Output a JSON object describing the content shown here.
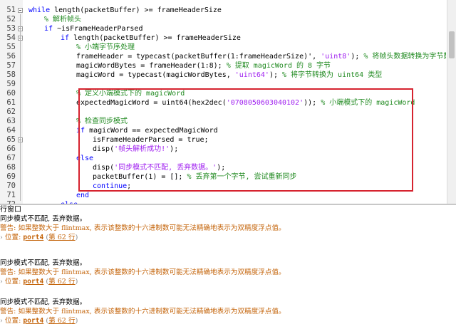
{
  "editor": {
    "lines": [
      {
        "num": "51",
        "fold": true
      },
      {
        "num": "52"
      },
      {
        "num": "53",
        "fold": true
      },
      {
        "num": "54",
        "fold": true
      },
      {
        "num": "55"
      },
      {
        "num": "56"
      },
      {
        "num": "57"
      },
      {
        "num": "58"
      },
      {
        "num": "59"
      },
      {
        "num": "60"
      },
      {
        "num": "61"
      },
      {
        "num": "62"
      },
      {
        "num": "63"
      },
      {
        "num": "64"
      },
      {
        "num": "65",
        "fold": true
      },
      {
        "num": "66"
      },
      {
        "num": "67"
      },
      {
        "num": "68"
      },
      {
        "num": "69"
      },
      {
        "num": "70"
      },
      {
        "num": "71"
      },
      {
        "num": "72"
      },
      {
        "num": "73"
      }
    ],
    "code": {
      "l51_kw": "while",
      "l51_rest": " length(packetBuffer) >= frameHeaderSize",
      "l52_cm": "% 解析帧头",
      "l53_kw": "if",
      "l53_rest": " ~isFrameHeaderParsed",
      "l54_kw": "if",
      "l54_rest": " length(packetBuffer) >= frameHeaderSize",
      "l55_cm": "% 小端字节序处理",
      "l56_a": "frameHeader = typecast(packetBuffer(1:frameHeaderSize)', ",
      "l56_str": "'uint8'",
      "l56_b": "); ",
      "l56_cm": "% 将帧头数据转换为字节数组",
      "l57_a": "magicWordBytes = frameHeader(1:8); ",
      "l57_cm": "% 提取 magicWord 的 8 字节",
      "l58_a": "magicWord = typecast(magicWordBytes, ",
      "l58_str": "'uint64'",
      "l58_b": "); ",
      "l58_cm": "% 将字节转换为 uint64 类型",
      "l61_cm": "% 定义小端模式下的 magicWord",
      "l62_a": "expectedMagicWord = uint64(hex2dec(",
      "l62_str": "'0708050603040102'",
      "l62_b": ")); ",
      "l62_cm": "% 小端模式下的 magicWord",
      "l64_cm": "% 检查同步模式",
      "l65_kw": "if",
      "l65_rest": " magicWord == expectedMagicWord",
      "l66_a": "isFrameHeaderParsed = true;",
      "l67_a": "disp(",
      "l67_str": "'帧头解析成功!'",
      "l67_b": ");",
      "l68_kw": "else",
      "l69_a": "disp(",
      "l69_str": "'同步模式不匹配, 丢弃数据。'",
      "l69_b": ");",
      "l70_a": "packetBuffer(1) = []; ",
      "l70_cm": "% 丢弃第一个字节, 尝试重新同步",
      "l71_kw": "continue",
      "l71_b": ";",
      "l72_kw": "end",
      "l73_kw": "else"
    }
  },
  "command_window": {
    "title": "行窗口",
    "blocks": [
      {
        "msg": "同步模式不匹配, 丢弃数据。",
        "warn": "警告: 如果整数大于 flintmax, 表示该整数的十六进制数可能无法精确地表示为双精度浮点值。",
        "loc_prefix": "位置: ",
        "loc_func": "port4",
        "loc_line": "第 62 行"
      },
      {
        "msg": "同步模式不匹配, 丢弃数据。",
        "warn": "警告: 如果整数大于 flintmax, 表示该整数的十六进制数可能无法精确地表示为双精度浮点值。",
        "loc_prefix": "位置: ",
        "loc_func": "port4",
        "loc_line": "第 62 行"
      },
      {
        "msg": "同步模式不匹配, 丢弃数据。",
        "warn": "警告: 如果整数大于 flintmax, 表示该整数的十六进制数可能无法精确地表示为双精度浮点值。",
        "loc_prefix": "位置: ",
        "loc_func": "port4",
        "loc_line": "第 62 行"
      }
    ]
  },
  "colors": {
    "keyword": "#0000ff",
    "comment": "#228b22",
    "string": "#a020f0",
    "warning": "#c4640a",
    "highlight_box": "#d6232f"
  }
}
